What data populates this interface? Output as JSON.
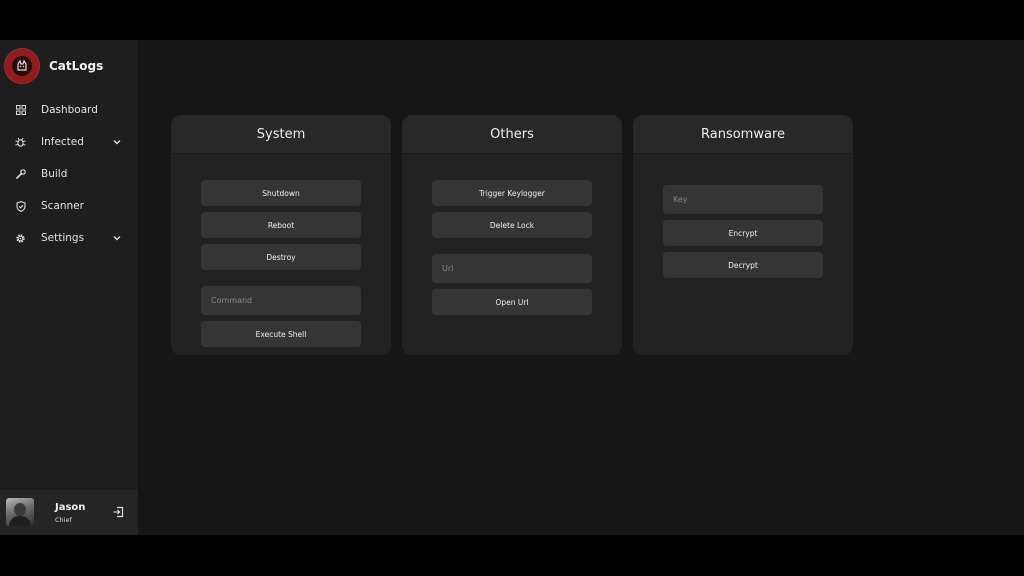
{
  "app": {
    "brand": "CatLogs"
  },
  "sidebar": {
    "items": [
      {
        "label": "Dashboard",
        "icon": "grid-icon"
      },
      {
        "label": "Infected",
        "icon": "bug-icon",
        "expandable": true
      },
      {
        "label": "Build",
        "icon": "wrench-icon"
      },
      {
        "label": "Scanner",
        "icon": "shield-icon"
      },
      {
        "label": "Settings",
        "icon": "gear-icon",
        "expandable": true
      }
    ]
  },
  "user": {
    "name": "Jason",
    "role": "Chief"
  },
  "panels": {
    "system": {
      "title": "System",
      "shutdown": "Shutdown",
      "reboot": "Reboot",
      "destroy": "Destroy",
      "command_placeholder": "Command",
      "execute": "Execute Shell"
    },
    "others": {
      "title": "Others",
      "keylogger": "Trigger Keylogger",
      "delete_lock": "Delete Lock",
      "url_placeholder": "Url",
      "open_url": "Open Url"
    },
    "ransomware": {
      "title": "Ransomware",
      "key_placeholder": "Key",
      "encrypt": "Encrypt",
      "decrypt": "Decrypt"
    }
  },
  "colors": {
    "background": "#161616",
    "sidebar": "#1e1e1e",
    "card": "#222222",
    "button": "#353535",
    "brand_red": "#8f1d1d"
  }
}
